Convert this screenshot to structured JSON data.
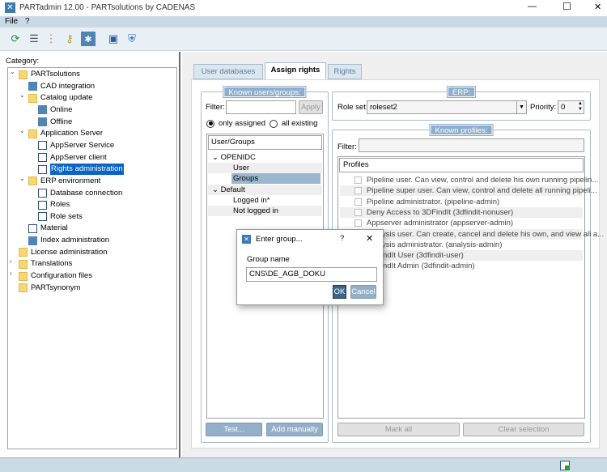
{
  "window": {
    "title": "PARTadmin 12.00 - PARTsolutions by CADENAS",
    "minimize": "—",
    "maximize": "☐",
    "close": "✕"
  },
  "menu": [
    "File",
    "?"
  ],
  "toolbar": [
    "refresh-icon",
    "disk-stack-icon",
    "tree-structure-icon",
    "keys-icon",
    "settings-icon",
    "save-icon",
    "shield-icon"
  ],
  "left": {
    "category_label": "Category:",
    "tree": [
      {
        "label": "PARTsolutions",
        "level": 0,
        "icon": "folder",
        "expanded": true
      },
      {
        "label": "CAD integration",
        "level": 1,
        "icon": "gear"
      },
      {
        "label": "Catalog update",
        "level": 1,
        "icon": "folder",
        "expanded": true
      },
      {
        "label": "Online",
        "level": 2,
        "icon": "gear"
      },
      {
        "label": "Offline",
        "level": 2,
        "icon": "gear"
      },
      {
        "label": "Application Server",
        "level": 1,
        "icon": "folder",
        "expanded": true
      },
      {
        "label": "AppServer Service",
        "level": 2,
        "icon": "page"
      },
      {
        "label": "AppServer client",
        "level": 2,
        "icon": "page"
      },
      {
        "label": "Rights administration",
        "level": 2,
        "icon": "page",
        "selected": true
      },
      {
        "label": "ERP environment",
        "level": 1,
        "icon": "folder",
        "expanded": true
      },
      {
        "label": "Database connection",
        "level": 2,
        "icon": "page"
      },
      {
        "label": "Roles",
        "level": 2,
        "icon": "page"
      },
      {
        "label": "Role sets",
        "level": 2,
        "icon": "page"
      },
      {
        "label": "Material",
        "level": 1,
        "icon": "page"
      },
      {
        "label": "Index administration",
        "level": 1,
        "icon": "gear"
      },
      {
        "label": "License administration",
        "level": 0,
        "icon": "folder"
      },
      {
        "label": "Translations",
        "level": 0,
        "icon": "folder",
        "collapsed": true
      },
      {
        "label": "Configuration files",
        "level": 0,
        "icon": "folder",
        "collapsed": true
      },
      {
        "label": "PARTsynonym",
        "level": 0,
        "icon": "folder"
      }
    ]
  },
  "tabs": [
    {
      "label": "User databases"
    },
    {
      "label": "Assign rights",
      "active": true
    },
    {
      "label": "Rights"
    }
  ],
  "users": {
    "title": "Known users/groups:",
    "filter_label": "Filter:",
    "filter_value": "",
    "apply": "Apply",
    "radio_assigned": "only assigned",
    "radio_all": "all existing",
    "selected_radio": "only assigned",
    "column": "User/Groups",
    "rows": [
      {
        "label": "OPENIDC",
        "level": 0
      },
      {
        "label": "User",
        "level": 1
      },
      {
        "label": "Groups",
        "level": 1,
        "selected": true
      },
      {
        "label": "Default",
        "level": 0
      },
      {
        "label": "Logged in*",
        "level": 1
      },
      {
        "label": "Not logged in",
        "level": 1
      }
    ],
    "test": "Test...",
    "add": "Add manually ..."
  },
  "erp": {
    "title": "ERP:",
    "roleset_label": "Role set:",
    "roleset_value": "roleset2",
    "priority_label": "Priority:",
    "priority_value": "0"
  },
  "profiles": {
    "title": "Known profiles:",
    "filter_label": "Filter:",
    "column": "Profiles",
    "items": [
      "Pipeline user. Can view, control and delete his own running pipelin...",
      "Pipeline super user. Can view, control and delete all running pipeli...",
      "Pipeline administrator. (pipeline-admin)",
      "Deny Access to 3DFindIt (3dfindit-nonuser)",
      "Appserver administrator (appserver-admin)",
      "Analysis user. Can create, cancel and delete his own, and view all a...",
      "Analysis administrator. (analysis-admin)",
      "3DFindIt User (3dfindit-user)",
      "3DFindIt Admin (3dfindit-admin)"
    ],
    "mark_all": "Mark all",
    "clear": "Clear selection"
  },
  "dialog": {
    "title": "Enter group...",
    "help": "?",
    "close": "✕",
    "label": "Group name",
    "value": "CNS\\DE_AGB_DOKU",
    "ok": "OK",
    "cancel": "Cancel"
  }
}
